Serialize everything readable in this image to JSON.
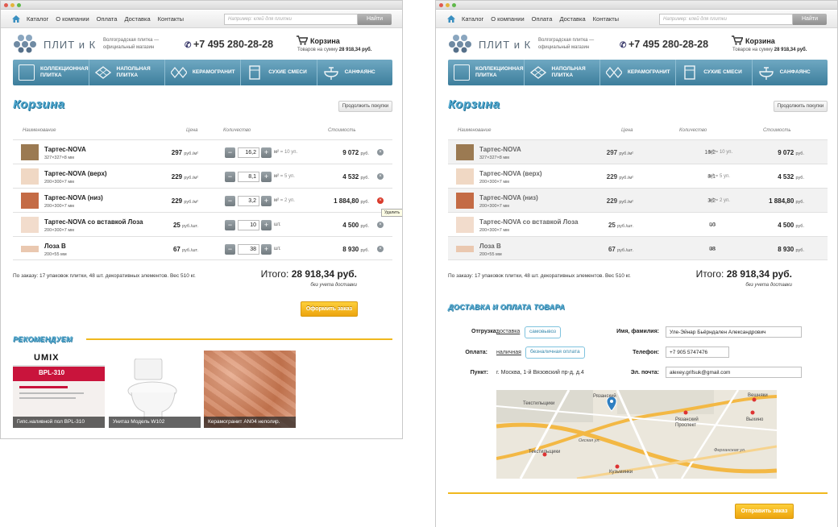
{
  "nav": {
    "links": [
      "Каталог",
      "О компании",
      "Оплата",
      "Доставка",
      "Контакты"
    ],
    "search_placeholder": "Например: клей для плитки",
    "search_button": "Найти"
  },
  "header": {
    "logo_text": "ПЛИТ и К",
    "tagline": "Волгоградская плитка — официальный магазин",
    "phone": "+7 495 280-28-28",
    "cart_title": "Корзина",
    "cart_summary": "Товаров на сумму",
    "cart_total": "28 918,34 руб."
  },
  "categories": [
    {
      "label": "Коллекционная плитка",
      "icon": "collection-tile-icon"
    },
    {
      "label": "Напольная плитка",
      "icon": "floor-tile-icon"
    },
    {
      "label": "Керамогранит",
      "icon": "porcelain-icon"
    },
    {
      "label": "Сухие смеси",
      "icon": "dry-mix-icon"
    },
    {
      "label": "Санфаянс",
      "icon": "sink-icon"
    }
  ],
  "page": {
    "title": "Корзина",
    "continue_button": "Продолжить покупки"
  },
  "table": {
    "headers": {
      "name": "Наименование",
      "price": "Цена",
      "qty": "Количество",
      "cost": "Стоимость"
    }
  },
  "items": [
    {
      "name": "Тартес-NOVA",
      "size": "327×327×8 мм",
      "price": "297",
      "price_unit": "руб./м²",
      "qty": "16,2",
      "unit": "м²",
      "pack": "= 10 уп.",
      "cost": "9 072",
      "cost_unit": "руб.",
      "color": "#9b7a52"
    },
    {
      "name": "Тартес-NOVA (верх)",
      "size": "200×300×7 мм",
      "price": "229",
      "price_unit": "руб./м²",
      "qty": "8,1",
      "unit": "м²",
      "pack": "= 5 уп.",
      "cost": "4 532",
      "cost_unit": "руб.",
      "color": "#f0d8c4"
    },
    {
      "name": "Тартес-NOVA (низ)",
      "size": "200×300×7 мм",
      "price": "229",
      "price_unit": "руб./м²",
      "qty": "3,2",
      "unit": "м²",
      "pack": "= 2 уп.",
      "cost": "1 884,80",
      "cost_unit": "руб.",
      "color": "#c46b45"
    },
    {
      "name": "Тартес-NOVA со вставкой Лоза",
      "size": "200×300×7 мм",
      "price": "25",
      "price_unit": "руб./шт.",
      "qty": "10",
      "unit": "шт.",
      "pack": "",
      "cost": "4 500",
      "cost_unit": "руб.",
      "color": "#f2dccc"
    },
    {
      "name": "Лоза В",
      "size": "200×55 мм",
      "price": "67",
      "price_unit": "руб./шт.",
      "qty": "38",
      "unit": "шт.",
      "pack": "",
      "cost": "8 930",
      "cost_unit": "руб.",
      "color": "#eac8b0"
    }
  ],
  "delete_tooltip": "Удалить",
  "summary": {
    "order_info": "По заказу: 17 упаковок плитки, 48 шт. декоративных элементов. Вес 510 кг.",
    "total_label": "Итого:",
    "total_value": "28 918,34 руб.",
    "no_delivery": "без учета доставки",
    "order_button": "Оформить заказ"
  },
  "recommend": {
    "title": "Рекомендуем",
    "items": [
      {
        "caption": "Гипс.наливной пол BPL-310",
        "brand": "UMIX",
        "code": "BPL-310"
      },
      {
        "caption": "Унитаз Модель W102"
      },
      {
        "caption": "Керамогранит AN04 неполир."
      }
    ]
  },
  "delivery": {
    "title": "Доставка и оплата товара",
    "ship_label": "Отгрузка:",
    "ship_option1": "доставка",
    "ship_option2": "самовывоз",
    "pay_label": "Оплата:",
    "pay_option1": "наличная",
    "pay_option2": "безналичная оплата",
    "point_label": "Пункт:",
    "point_value": "г. Москва, 1-й Вязовский пр-д, д.4",
    "name_label": "Имя, фамилия:",
    "name_value": "Уле-Эйнар Бьёрндален Александрович",
    "phone_label": "Телефон:",
    "phone_value": "+7 905 5747476",
    "email_label": "Эл. почта:",
    "email_value": "alexey.grifsuk@gmail.com",
    "send_button": "Отправить заказ"
  },
  "map": {
    "labels": [
      "Рязанский",
      "Текстильщики",
      "Текстильщики",
      "Рязанский Проспект",
      "Выхино",
      "Вешняки",
      "Кузьминки",
      "Окская ул.",
      "Ферганская ул."
    ]
  }
}
